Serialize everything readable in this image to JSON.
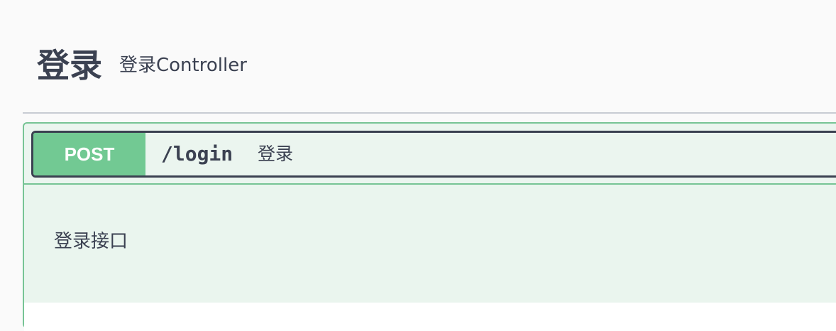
{
  "tag": {
    "name": "登录",
    "description": "登录Controller"
  },
  "operation": {
    "method": "POST",
    "path": "/login",
    "summary": "登录",
    "description": "登录接口"
  },
  "colors": {
    "post_accent": "#72c993",
    "post_border": "#77c495",
    "post_background": "#ebf5ef",
    "text": "#3b4151"
  }
}
